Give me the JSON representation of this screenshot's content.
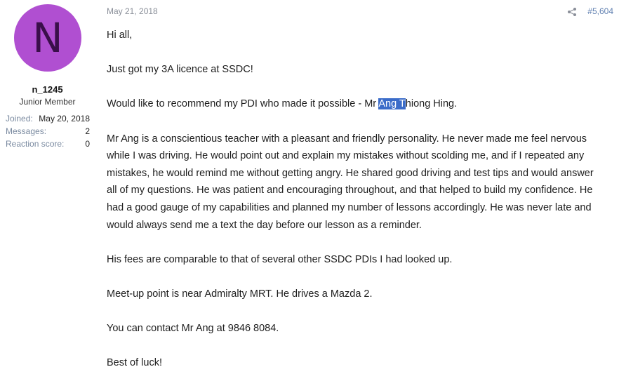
{
  "user": {
    "avatar_letter": "N",
    "avatar_color": "#b04fd1",
    "username": "n_1245",
    "title": "Junior Member",
    "stats": [
      {
        "label": "Joined:",
        "value": "May 20, 2018"
      },
      {
        "label": "Messages:",
        "value": "2"
      },
      {
        "label": "Reaction score:",
        "value": "0"
      }
    ]
  },
  "post": {
    "date": "May 21, 2018",
    "share_icon": "share-icon",
    "number": "#5,604",
    "greeting": "Hi all,",
    "p1": "Just got my 3A licence at SSDC!",
    "p2_before": "Would like to recommend my PDI who made it possible - Mr ",
    "p2_highlight": "Ang T",
    "p2_after": "hiong Hing.",
    "p3_l1": "Mr Ang is a conscientious teacher with a pleasant and friendly personality. He never made me feel nervous",
    "p3_l2": "while I was driving. He would point out and explain my mistakes without scolding me, and if I repeated any",
    "p3_l3": "mistakes, he would remind me without getting angry. He shared good driving and test tips and would answer",
    "p3_l4": "all of my questions. He was patient and encouraging throughout, and that helped to build my confidence. He",
    "p3_l5": "had a good gauge of my capabilities and planned my number of lessons accordingly. He was never late and",
    "p3_l6": "would always send me a text the day before our lesson as a reminder.",
    "p4": "His fees are comparable to that of several other SSDC PDIs I had looked up.",
    "p5": "Meet-up point is near Admiralty MRT. He drives a Mazda 2.",
    "p6": "You can contact Mr Ang at 9846 8084.",
    "p7": "Best of luck!",
    "highlight_color": "#3b6cc9"
  }
}
